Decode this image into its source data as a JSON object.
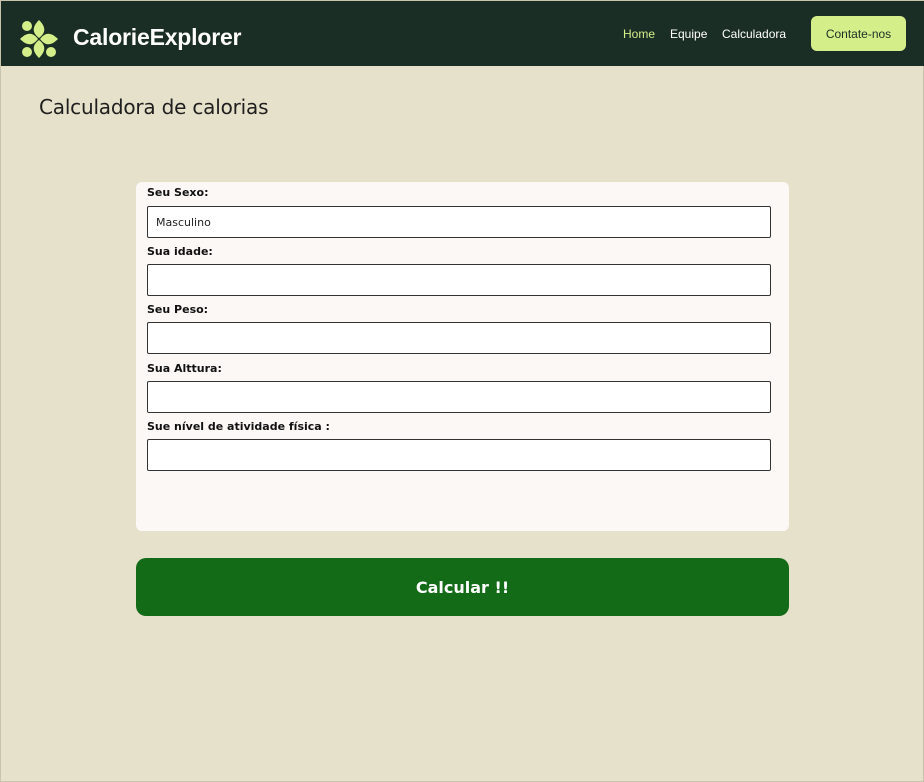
{
  "header": {
    "brand": "CalorieExplorer",
    "nav": {
      "home": "Home",
      "equipe": "Equipe",
      "calculadora": "Calculadora"
    },
    "contact_button": "Contate-nos",
    "colors": {
      "bar": "#1b2e25",
      "accent": "#d4ef8a"
    }
  },
  "main": {
    "title": "Calculadora de calorias",
    "form": {
      "sexo": {
        "label": "Seu Sexo:",
        "value": "Masculino"
      },
      "idade": {
        "label": "Sua idade:",
        "value": ""
      },
      "peso": {
        "label": "Seu Peso:",
        "value": ""
      },
      "altura": {
        "label": "Sua Alttura:",
        "value": ""
      },
      "atividade": {
        "label": "Sue nível de atividade física :",
        "value": ""
      }
    },
    "submit_button": "Calcular !!",
    "colors": {
      "background": "#e6e1ca",
      "button": "#136a17"
    }
  }
}
